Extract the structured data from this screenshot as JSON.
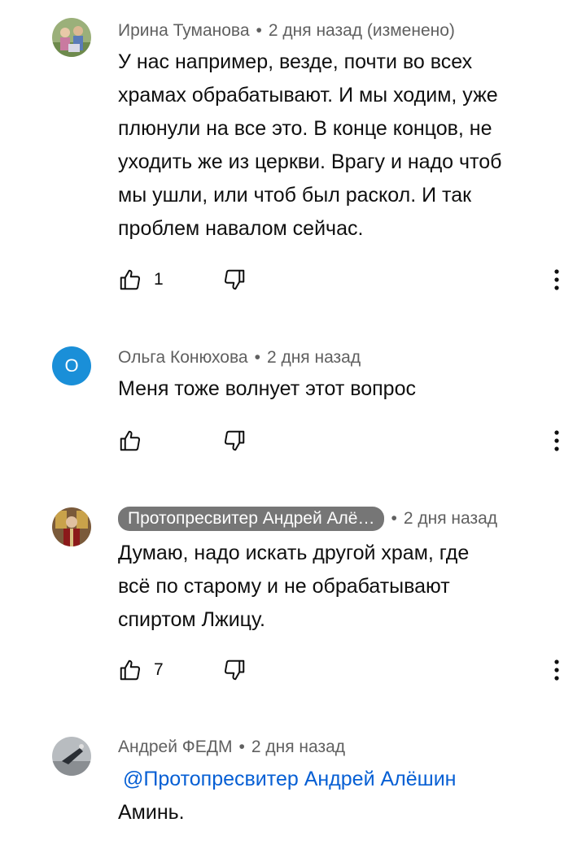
{
  "comments": [
    {
      "author": "Ирина Туманова",
      "separator": "•",
      "time": "2 дня назад (изменено)",
      "lines": [
        "У нас например, везде, почти во всех",
        "храмах обрабатывают. И мы ходим, уже",
        "плюнули на все это. В конце концов, не",
        "уходить же из церкви. Врагу и надо чтоб",
        "мы ушли, или чтоб был раскол. И так",
        "проблем навалом сейчас."
      ],
      "likes": "1"
    },
    {
      "author": "Ольга Конюхова",
      "avatar_letter": "О",
      "separator": "•",
      "time": "2 дня назад",
      "lines": [
        "Меня тоже волнует этот вопрос"
      ],
      "likes": ""
    },
    {
      "author": "Протопресвитер Андрей Алё…",
      "separator": "•",
      "time": "2 дня назад",
      "lines": [
        "Думаю, надо искать другой храм, где",
        "всё по старому и не обрабатывают",
        "спиртом Лжицу."
      ],
      "likes": "7"
    },
    {
      "author": "Андрей ФЕДМ",
      "separator": "•",
      "time": "2 дня назад",
      "mention": "@Протопресвитер Андрей Алёшин",
      "lines": [
        "Аминь."
      ]
    }
  ],
  "icons": {
    "like": "thumb-up-icon",
    "dislike": "thumb-down-icon",
    "more": "more-vert-icon"
  },
  "colors": {
    "meta_text": "#606060",
    "author_badge_bg": "#767676",
    "mention": "#065fd4",
    "avatar_letter_bg": "#1a8fd8"
  }
}
